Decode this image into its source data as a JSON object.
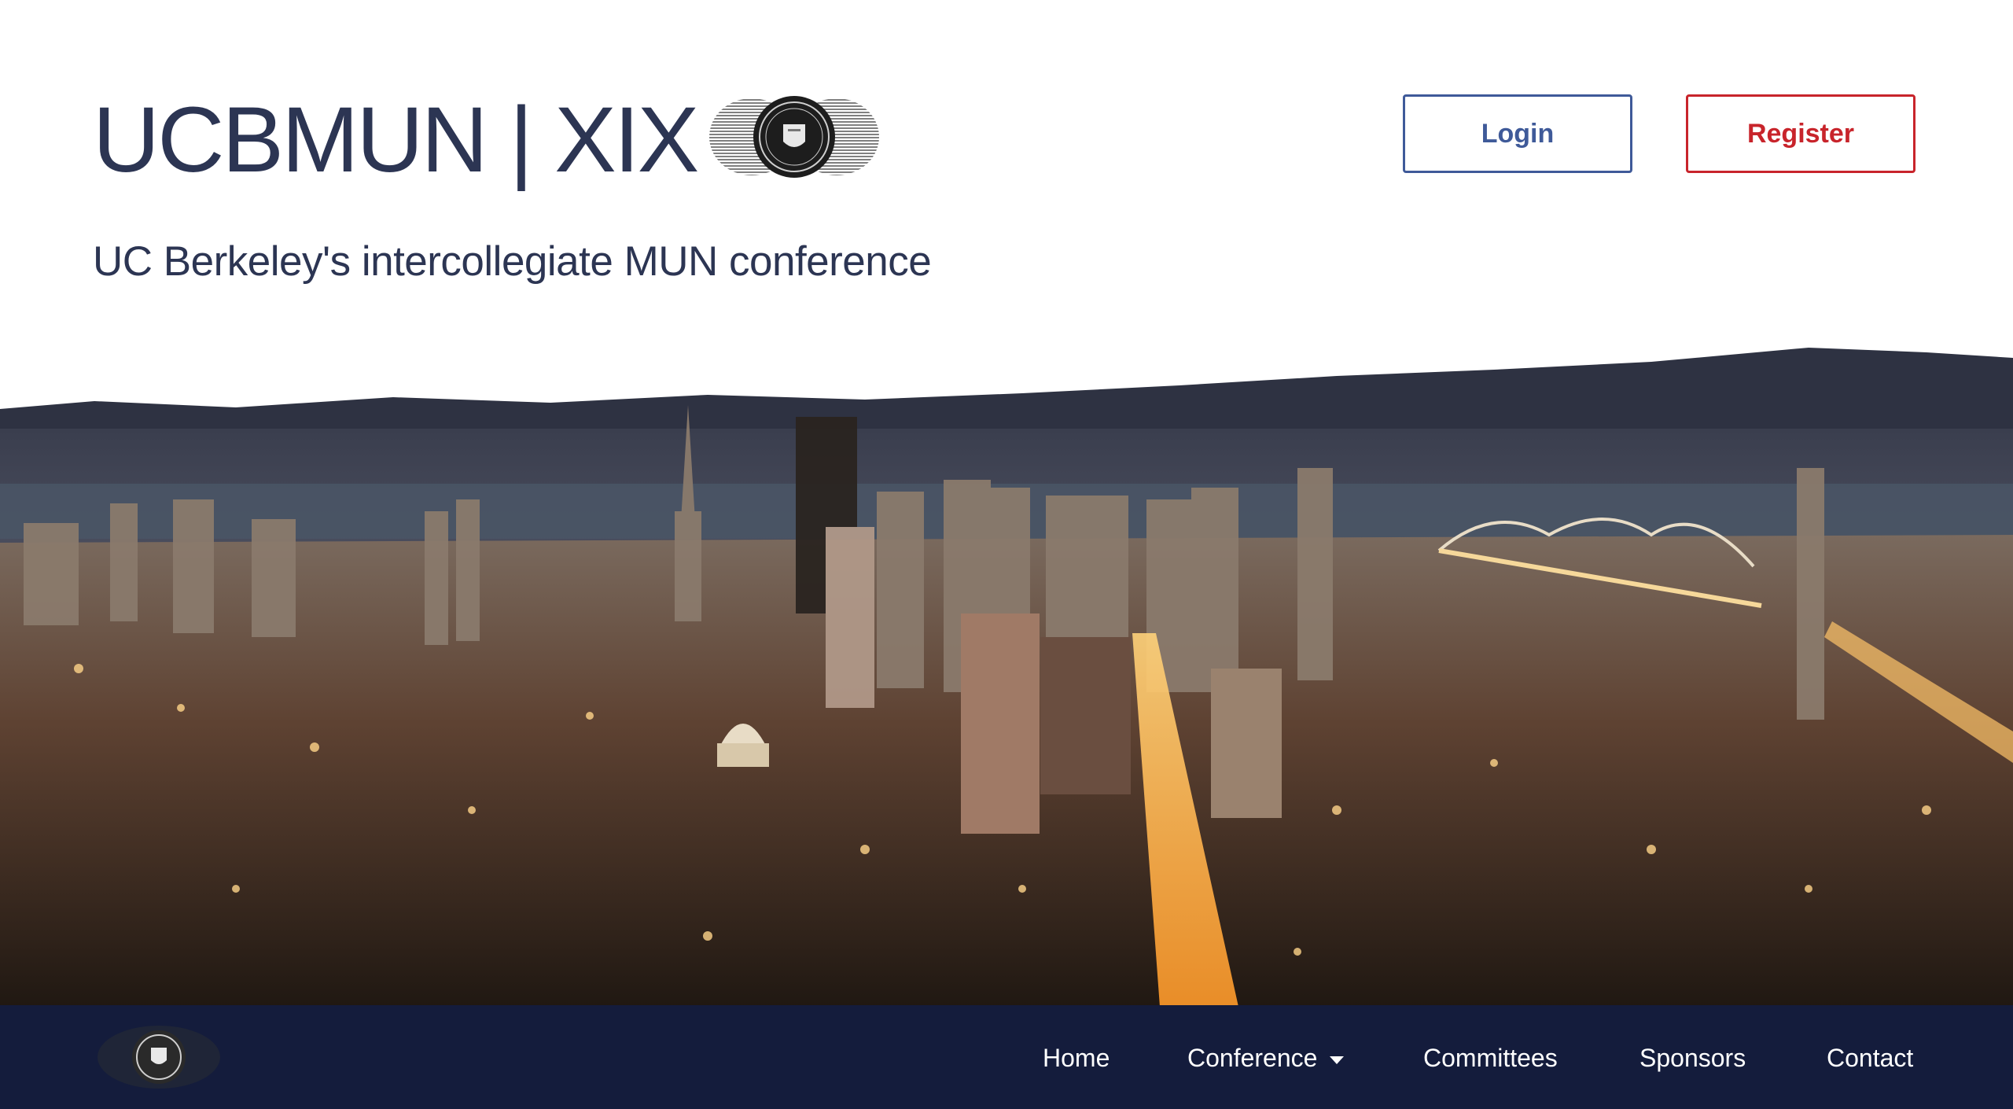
{
  "header": {
    "title": "UCBMUN | XIX",
    "tagline": "UC Berkeley's intercollegiate MUN conference",
    "login_label": "Login",
    "register_label": "Register"
  },
  "nav": {
    "items": [
      {
        "label": "Home"
      },
      {
        "label": "Conference",
        "has_dropdown": true
      },
      {
        "label": "Committees"
      },
      {
        "label": "Sponsors"
      },
      {
        "label": "Contact"
      }
    ]
  },
  "colors": {
    "title_text": "#2c3553",
    "login_accent": "#3f5a99",
    "register_accent": "#c8242b",
    "navbar_bg": "#141c3c"
  },
  "icons": {
    "logo": "ucbmun-seal-globe-logo",
    "nav_logo": "ucbmun-seal-icon",
    "dropdown": "caret-down-icon"
  }
}
